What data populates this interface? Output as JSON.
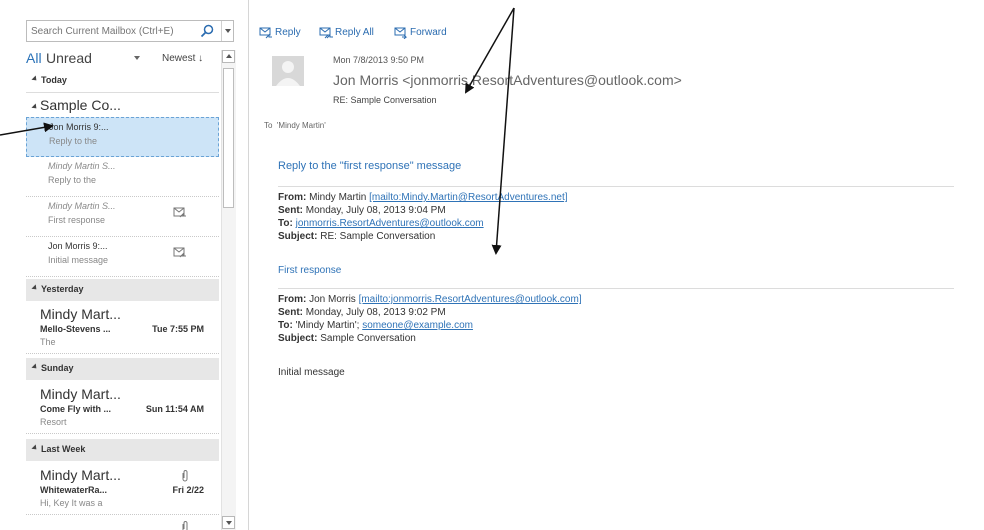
{
  "search": {
    "placeholder": "Search Current Mailbox (Ctrl+E)"
  },
  "filters": {
    "all": "All",
    "unread": "Unread",
    "sort": "Newest ↓"
  },
  "groups": {
    "today": "Today",
    "yesterday": "Yesterday",
    "sunday": "Sunday",
    "last_week": "Last Week"
  },
  "conversation": {
    "header": "Sample Co...",
    "items": [
      {
        "from": "Jon Morris  9:...",
        "preview": "Reply to the",
        "selected": true
      },
      {
        "from": "Mindy Martin S...",
        "preview": "Reply to the"
      },
      {
        "from": "Mindy Martin S...",
        "preview": "First response",
        "icon": "reply-icon"
      },
      {
        "from": "Jon Morris  9:...",
        "preview": "Initial message",
        "icon": "reply-icon"
      }
    ]
  },
  "messages": {
    "yesterday": {
      "name": "Mindy Mart...",
      "subject": "Mello-Stevens ...",
      "date": "Tue 7:55 PM",
      "preview": "The"
    },
    "sunday": {
      "name": "Mindy Mart...",
      "subject": "Come Fly with ...",
      "date": "Sun 11:54 AM",
      "preview": "Resort"
    },
    "last_week": {
      "name": "Mindy Mart...",
      "subject": "WhitewaterRa...",
      "date": "Fri 2/22",
      "preview": "Hi,  Key It was a",
      "icon": "paperclip-icon"
    },
    "last_week_2": {
      "icon": "paperclip-icon"
    }
  },
  "toolbar": {
    "reply": "Reply",
    "reply_all": "Reply All",
    "forward": "Forward"
  },
  "header": {
    "date": "Mon 7/8/2013 9:50 PM",
    "from": "Jon Morris <jonmorris.ResortAdventures@outlook.com>",
    "subject": "RE: Sample Conversation",
    "to_label": "To",
    "to_value": "'Mindy Martin'"
  },
  "body": {
    "reply_title": "Reply to the \"first response\" message",
    "block1": {
      "from_label": "From:",
      "from_value": " Mindy Martin ",
      "from_link": "[mailto:Mindy.Martin@ResortAdventures.net]",
      "sent_label": "Sent:",
      "sent_value": " Monday, July 08, 2013 9:04 PM",
      "to_label": "To:",
      "to_link": "jonmorris.ResortAdventures@outlook.com",
      "subject_label": "Subject:",
      "subject_value": " RE: Sample Conversation"
    },
    "first_response": "First response",
    "block2": {
      "from_label": "From:",
      "from_value": " Jon Morris ",
      "from_link": "[mailto:jonmorris.ResortAdventures@outlook.com]",
      "sent_label": "Sent:",
      "sent_value": " Monday, July 08, 2013 9:02 PM",
      "to_label": "To:",
      "to_value": " 'Mindy Martin'; ",
      "to_link": "someone@example.com",
      "subject_label": "Subject:",
      "subject_value": " Sample Conversation"
    },
    "initial": "Initial message"
  }
}
